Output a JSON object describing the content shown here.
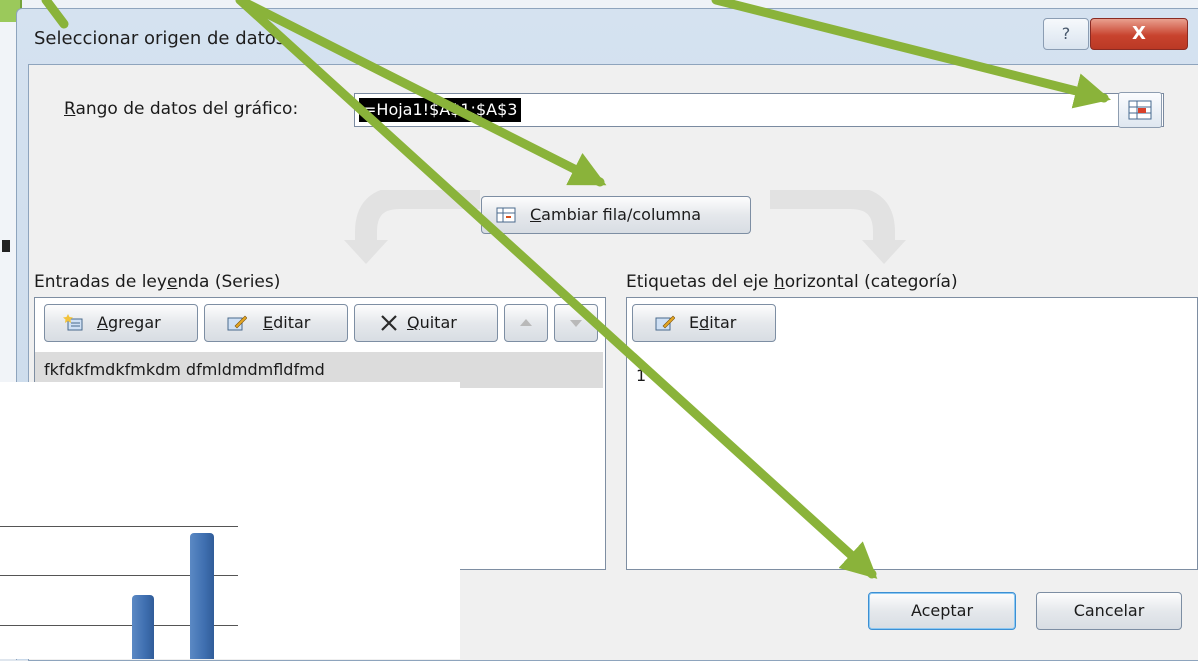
{
  "dialog": {
    "title": "Seleccionar origen de datos",
    "help_label": "?",
    "close_label": "X"
  },
  "range": {
    "label_prefix": "R",
    "label_rest": "ango de datos del gráfico:",
    "value": "=Hoja1!$A$1:$A$3"
  },
  "switch_button": {
    "label_underlined": "C",
    "label_rest": "ambiar fila/columna"
  },
  "series_panel": {
    "label_part1": "Entradas de ley",
    "label_underlined": "e",
    "label_part2": "nda (Series)",
    "add_underlined": "A",
    "add_rest": "gregar",
    "edit_underlined": "E",
    "edit_rest": "ditar",
    "remove_underlined": "Q",
    "remove_rest": "uitar",
    "items": [
      "fkfdkfmdkfmkdm dfmldmdmfldfmd"
    ]
  },
  "category_panel": {
    "label_part1": "Etiquetas del eje ",
    "label_underlined": "h",
    "label_part2": "orizontal (categoría)",
    "edit_prefix": "E",
    "edit_underlined": "d",
    "edit_rest": "itar",
    "items": [
      "1"
    ]
  },
  "footer": {
    "ok_label": "Aceptar",
    "cancel_label": "Cancelar"
  },
  "chart": {
    "bar_values": [
      0.28,
      0.55
    ],
    "bar_color": "#3f6fb0"
  },
  "annotation_color": "#8ab33a"
}
